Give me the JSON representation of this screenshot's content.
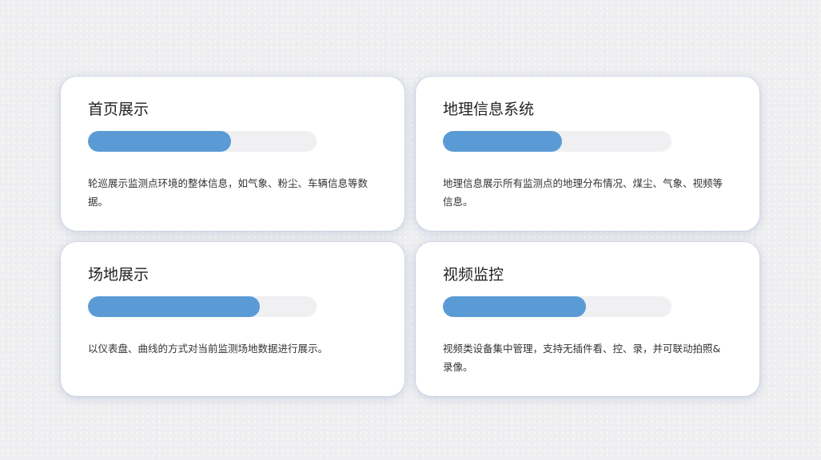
{
  "cards": [
    {
      "title": "首页展示",
      "progress": 0.625,
      "description": "轮巡展示监测点环境的整体信息，如气象、粉尘、车辆信息等数据。",
      "accent_color": "#5b9bd5"
    },
    {
      "title": "地理信息系统",
      "progress": 0.52,
      "description": "地理信息展示所有监测点的地理分布情况、煤尘、气象、视频等信息。",
      "accent_color": "#5b9bd5"
    },
    {
      "title": "场地展示",
      "progress": 0.75,
      "description": "以仪表盘、曲线的方式对当前监测场地数据进行展示。",
      "accent_color": "#5b9bd5"
    },
    {
      "title": "视频监控",
      "progress": 0.625,
      "description": "视频类设备集中管理，支持无插件看、控、录，并可联动拍照&录像。",
      "accent_color": "#5b9bd5"
    }
  ]
}
